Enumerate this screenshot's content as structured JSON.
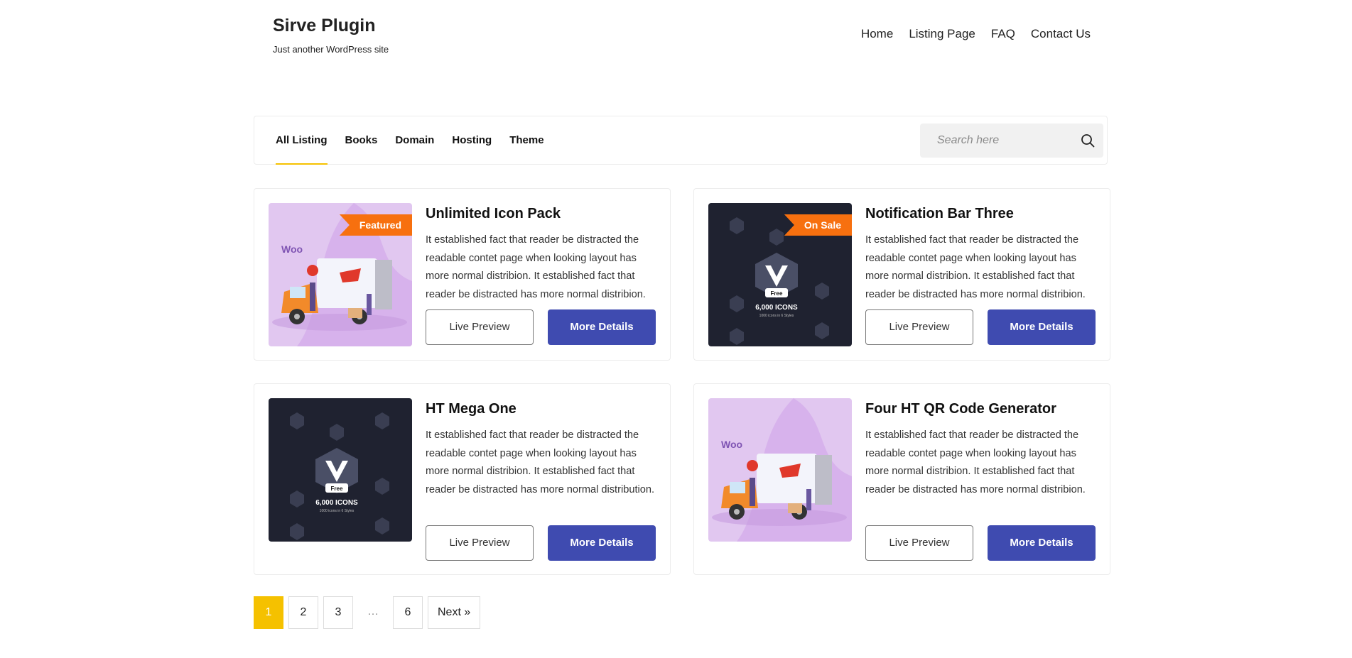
{
  "site": {
    "title": "Sirve Plugin",
    "tagline": "Just another WordPress site"
  },
  "nav": [
    "Home",
    "Listing Page",
    "FAQ",
    "Contact Us"
  ],
  "filter": {
    "tabs": [
      "All Listing",
      "Books",
      "Domain",
      "Hosting",
      "Theme"
    ],
    "active_tab": "All Listing"
  },
  "search": {
    "placeholder": "Search here",
    "value": ""
  },
  "cards": [
    {
      "title": "Unlimited Icon Pack",
      "badge": "Featured",
      "image": "woo-delivery-truck",
      "description": "It established fact that reader be distracted the readable contet page when looking layout has more normal distribion. It established fact that reader be distracted has more normal distribion.",
      "preview_label": "Live Preview",
      "details_label": "More Details"
    },
    {
      "title": "Notification Bar Three",
      "badge": "On Sale",
      "image": "icon-pack-dark",
      "description": "It established fact that reader be distracted the readable contet page when looking layout has more normal distribion. It established fact that reader be distracted has more normal distribion.",
      "preview_label": "Live Preview",
      "details_label": "More Details"
    },
    {
      "title": "HT Mega One",
      "badge": "",
      "image": "icon-pack-dark",
      "description": "It established fact that reader be distracted the readable contet page when looking layout has more normal distribion. It established fact that reader be distracted has more normal distribution.",
      "preview_label": "Live Preview",
      "details_label": "More Details"
    },
    {
      "title": "Four HT QR Code Generator",
      "badge": "",
      "image": "woo-delivery-truck",
      "description": "It established fact that reader be distracted the readable contet page when looking layout has more normal distribion. It established fact that reader be distracted has more normal distribion.",
      "preview_label": "Live Preview",
      "details_label": "More Details"
    }
  ],
  "image_text": {
    "woo": "Woo",
    "free": "Free",
    "icons": "6,000 ICONS",
    "icons_sub": "1000 icons in 6 Styles"
  },
  "pagination": {
    "pages": [
      "1",
      "2",
      "3",
      "…",
      "6"
    ],
    "current": "1",
    "next_label": "Next »"
  },
  "colors": {
    "accent": "#f5c100",
    "button": "#3f4bb0",
    "badge": "#f7700f"
  }
}
